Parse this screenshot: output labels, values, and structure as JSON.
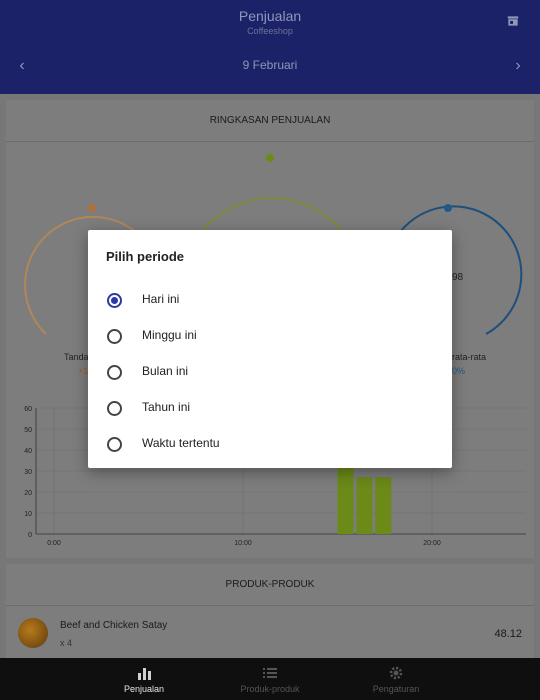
{
  "header": {
    "title": "Penjualan",
    "subtitle": "Coffeeshop",
    "date": "9  Februari",
    "prev_icon": "chevron-left-icon",
    "next_icon": "chevron-right-icon",
    "store_icon": "store-icon"
  },
  "summary": {
    "title": "RINGKASAN PENJUALAN",
    "left_label": "Tanda",
    "left_sub": "+1",
    "right_value": "98",
    "right_label": "rata-rata",
    "right_sub": "0%",
    "colors": {
      "left": "#c48a4a",
      "center": "#7a8a2e",
      "right": "#1e6fb0"
    }
  },
  "chart_data": {
    "type": "bar",
    "x_ticks": [
      "0:00",
      "10:00",
      "20:00"
    ],
    "y_ticks": [
      "0",
      "10",
      "20",
      "30",
      "40",
      "50",
      "60"
    ],
    "ylim": [
      0,
      60
    ],
    "bar_color": "#6b8a18",
    "bars": [
      {
        "hour": 15,
        "value": 35
      },
      {
        "hour": 16,
        "value": 27
      },
      {
        "hour": 17,
        "value": 27
      }
    ]
  },
  "products": {
    "title": "PRODUK-PRODUK",
    "items": [
      {
        "name": "Beef and Chicken Satay",
        "qty": "x 4",
        "price": "48.12"
      }
    ]
  },
  "bottom_nav": {
    "items": [
      {
        "label": "Penjualan",
        "icon": "bar-chart-icon",
        "active": true
      },
      {
        "label": "Produk-produk",
        "icon": "list-icon",
        "active": false
      },
      {
        "label": "Pengaturan",
        "icon": "gear-icon",
        "active": false
      }
    ]
  },
  "dialog": {
    "title": "Pilih periode",
    "options": [
      {
        "label": "Hari ini",
        "selected": true
      },
      {
        "label": "Minggu ini",
        "selected": false
      },
      {
        "label": "Bulan ini",
        "selected": false
      },
      {
        "label": "Tahun ini",
        "selected": false
      },
      {
        "label": "Waktu tertentu",
        "selected": false
      }
    ]
  }
}
